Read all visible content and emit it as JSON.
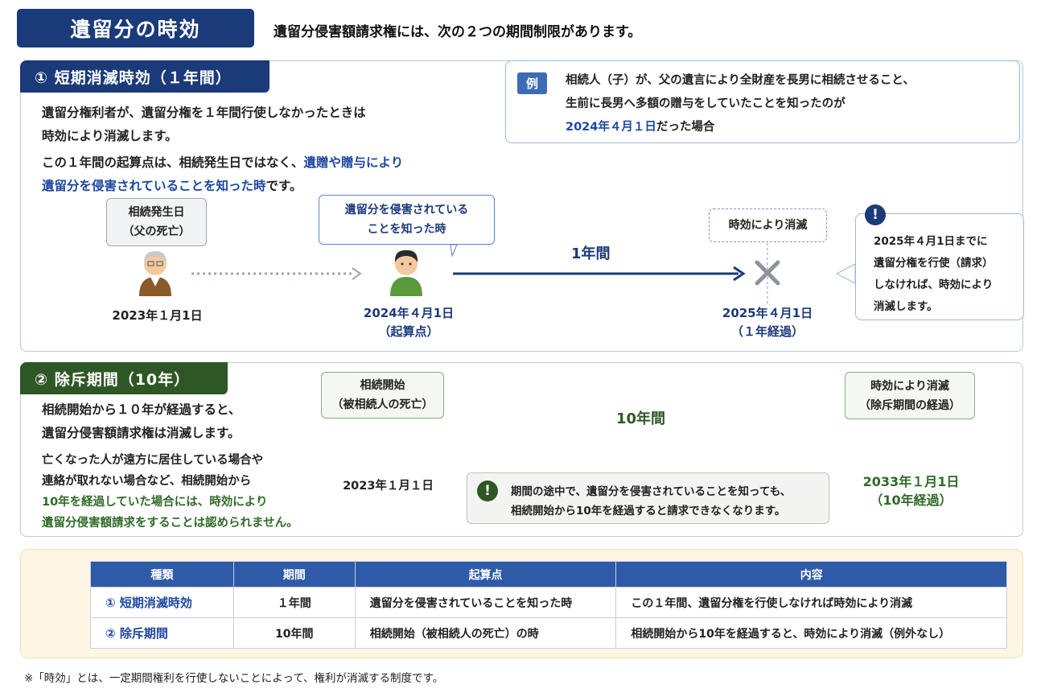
{
  "title": "遺留分の時効",
  "intro": "遺留分侵害額請求権には、次の２つの期間制限があります。",
  "section1": {
    "header": "① 短期消滅時効（１年間）",
    "p1_line1": "遺留分権利者が、遺留分権を１年間行使しなかったときは",
    "p1_line2": "時効により消滅します。",
    "p2_line1_a": "この１年間の起算点は、相続発生日ではなく、",
    "p2_line1_b": "遺贈や贈与により",
    "p2_line2_a": "遺留分を侵害されていることを知った時",
    "p2_line2_b": "です。",
    "example": {
      "badge": "例",
      "line1": "相続人（子）が、父の遺言により全財産を長男に相続させること、",
      "line2": "生前に長男へ多額の贈与をしていたことを知ったのが",
      "line3_date": "2024年４月１日",
      "line3_rest": "だった場合"
    },
    "box_inherit": {
      "line1": "相続発生日",
      "line2": "（父の死亡）"
    },
    "box_know": {
      "line1": "遺留分を侵害されている",
      "line2": "ことを知った時"
    },
    "box_expire": "時効により消滅",
    "date_inherit": "2023年１月1日",
    "date_know": {
      "line1": "2024年４月1日",
      "line2": "（起算点）"
    },
    "date_expire": {
      "line1": "2025年４月1日",
      "line2": "（１年経過）"
    },
    "period_label": "1年間",
    "note": {
      "icon": "!",
      "line1": "2025年４月1日までに",
      "line2": "遺留分権を行使（請求）",
      "line3": "しなければ、時効により",
      "line4": "消滅します。"
    }
  },
  "section2": {
    "header": "② 除斥期間（10年）",
    "p1_line1": "相続開始から１０年が経過すると、",
    "p1_line2": "遺留分侵害額請求権は消滅します。",
    "p2_line1": "亡くなった人が遠方に居住している場合や",
    "p2_line2": "連絡が取れない場合など、相続開始から",
    "p2_line3_a": "10年を経過していた場合には、",
    "p2_line3_b": "時効により",
    "p2_line4": "遺留分侵害額請求をすることは認められません。",
    "box_start": {
      "line1": "相続開始",
      "line2": "（被相続人の死亡）"
    },
    "box_expire": {
      "line1": "時効により消滅",
      "line2": "（除斥期間の経過）"
    },
    "date_start": "2023年１月１日",
    "date_expire": {
      "line1": "2033年１月1日",
      "line2": "（10年経過）"
    },
    "period_label": "10年間",
    "note": {
      "icon": "!",
      "line1": "期間の途中で、遺留分を侵害されていることを知っても、",
      "line2": "相続開始から10年を経過すると請求できなくなります。"
    }
  },
  "table": {
    "headers": [
      "種類",
      "期間",
      "起算点",
      "内容"
    ],
    "rows": [
      [
        "① 短期消滅時効",
        "１年間",
        "遺留分を侵害されていることを知った時",
        "この１年間、遺留分権を行使しなければ時効により消滅"
      ],
      [
        "② 除斥期間",
        "10年間",
        "相続開始（被相続人の死亡）の時",
        "相続開始から10年を経過すると、時効により消滅（例外なし）"
      ]
    ]
  },
  "footnote": "※「時効」とは、一定期間権利を行使しないことによって、権利が消滅する制度です。",
  "colors": {
    "navy": "#1b3a7a",
    "green": "#2f5726",
    "accent_blue": "#1d47a0",
    "table_header": "#2f5aa8",
    "cream": "#fdf6e5"
  }
}
